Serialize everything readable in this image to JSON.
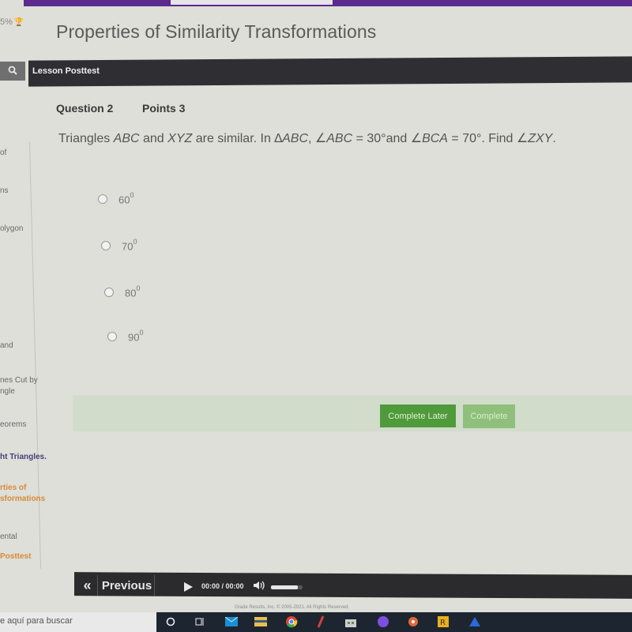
{
  "header": {
    "progress_text": "5%",
    "trophy_icon": "🏆",
    "title": "Properties of Similarity Transformations"
  },
  "lesson_bar": {
    "search_icon": "🔍",
    "label": "Lesson Posttest"
  },
  "sidebar": {
    "items": [
      {
        "label": "of",
        "style": "normal"
      },
      {
        "label": "ns",
        "style": "normal"
      },
      {
        "label": "olygon",
        "style": "normal"
      },
      {
        "label": "and",
        "style": "normal"
      },
      {
        "label": "nes Cut by",
        "style": "normal"
      },
      {
        "label": "ngle",
        "style": "normal"
      },
      {
        "label": "eorems",
        "style": "normal"
      },
      {
        "label": "ht Triangles.",
        "style": "purple"
      },
      {
        "label": "rties of",
        "style": "orange"
      },
      {
        "label": "sformations",
        "style": "orange"
      },
      {
        "label": "ental",
        "style": "normal"
      },
      {
        "label": "Posttest",
        "style": "orange"
      }
    ]
  },
  "question": {
    "number_label": "Question 2",
    "points_label": "Points 3",
    "text_parts": {
      "p1": "Triangles ",
      "abc": "ABC",
      "p2": " and ",
      "xyz": "XYZ",
      "p3": " are similar. In ∆",
      "abc2": "ABC",
      "p4": ", ∠",
      "abc3": "ABC",
      "p5": " = 30°and ∠",
      "bca": "BCA",
      "p6": " = 70°.  Find ∠",
      "zxy": "ZXY",
      "p7": "."
    },
    "options": [
      {
        "value": "60",
        "sup": "0"
      },
      {
        "value": "70",
        "sup": "0"
      },
      {
        "value": "80",
        "sup": "0"
      },
      {
        "value": "90",
        "sup": "0"
      }
    ]
  },
  "actions": {
    "complete_later": "Complete Later",
    "complete": "Complete"
  },
  "player": {
    "previous_icon": "«",
    "previous_label": "Previous",
    "time": "00:00 / 00:00",
    "volume_icon": "🔊",
    "volume_level": 0.85
  },
  "footer": {
    "copyright": "Grade Results, Inc. © 2005-2021. All Rights Reserved."
  },
  "taskbar": {
    "search_placeholder": "e aquí para buscar",
    "icons": [
      "cortana-icon",
      "task-view-icon",
      "mail-icon",
      "file-explorer-icon",
      "chrome-icon",
      "app-icon",
      "store-icon",
      "app-icon-2",
      "app-icon-3",
      "app-icon-4",
      "app-icon-5"
    ]
  }
}
